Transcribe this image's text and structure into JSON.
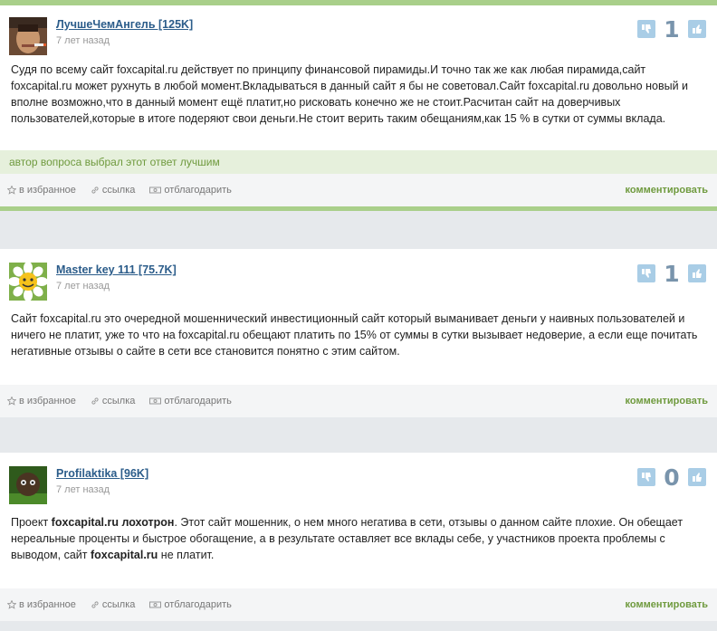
{
  "answers": [
    {
      "author": "ЛучшеЧемАнгель [125K]",
      "time": "7 лет назад",
      "vote_count": "1",
      "text": "Судя по всему сайт foxcapital.ru действует по принципу финансовой пирамиды.И точно так же как любая пирамида,сайт foxcapital.ru может рухнуть в любой момент.Вкладываться в данный сайт я бы не советовал.Сайт foxcapital.ru довольно новый и вполне возможно,что в данный момент ещё платит,но рисковать конечно же не стоит.Расчитан сайт на доверчивых пользователей,которые в итоге подеряют свои деньги.Не стоит верить таким обещаниям,как 15 % в сутки от суммы вклада.",
      "best_label": "автор вопроса выбрал этот ответ лучшим"
    },
    {
      "author": "Master key 111 [75.7K]",
      "time": "7 лет назад",
      "vote_count": "1",
      "text": "Сайт foxcapital.ru это очередной мошеннический инвестиционный сайт который выманивает деньги у наивных пользователей и ничего не платит, уже то что на foxcapital.ru обещают платить по 15% от суммы в сутки вызывает недоверие, а если еще почитать негативные отзывы о сайте в сети все становится понятно с этим сайтом."
    },
    {
      "author": "Profilaktika [96K]",
      "time": "7 лет назад",
      "vote_count": "0",
      "text_parts": [
        "Проект ",
        "foxcapital.ru лохотрон",
        ". Этот сайт мошенник, о нем много негатива в сети, отзывы о данном сайте плохие. Он обещает нереальные проценты и быстрое обогащение, а в результате оставляет все вклады себе, у участников проекта проблемы с выводом, сайт ",
        "foxcapital.ru",
        " не платит."
      ]
    }
  ],
  "actions": {
    "favorite": "в избранное",
    "link": "ссылка",
    "thank": "отблагодарить",
    "comment": "комментировать"
  },
  "colors": {
    "accent_green": "#a9cf8a",
    "link_blue": "#2b5c8a",
    "vote_button": "#a9cde6"
  }
}
